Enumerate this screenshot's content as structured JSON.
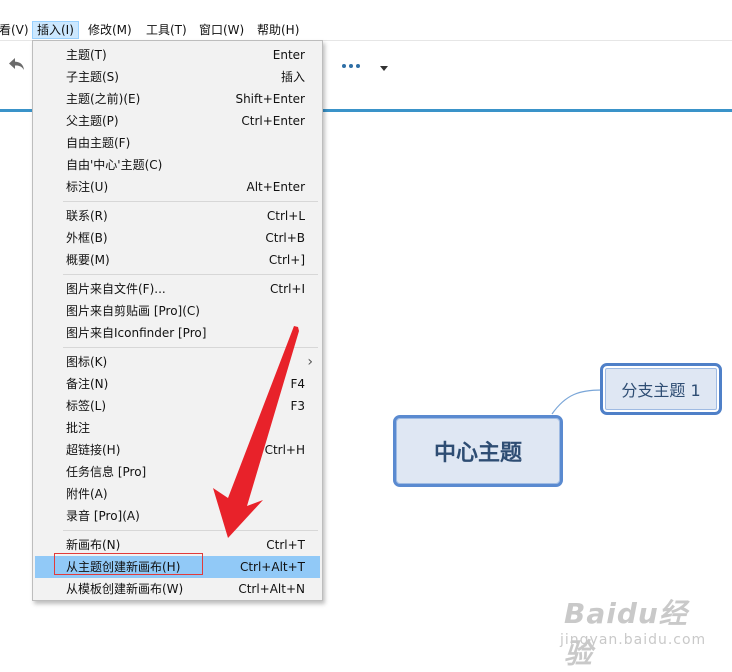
{
  "menubar": [
    {
      "label": "看(V)"
    },
    {
      "label": "插入(I)",
      "active": true
    },
    {
      "label": "修改(M)"
    },
    {
      "label": "工具(T)"
    },
    {
      "label": "窗口(W)"
    },
    {
      "label": "帮助(H)"
    }
  ],
  "toolbar": {
    "undo_icon": "undo-icon",
    "more_icon": "more-horizontal-icon",
    "dropdown_icon": "caret-down-icon"
  },
  "insert_menu": {
    "groups": [
      [
        {
          "label": "主题(T)",
          "shortcut": "Enter"
        },
        {
          "label": "子主题(S)",
          "shortcut": "插入"
        },
        {
          "label": "主题(之前)(E)",
          "shortcut": "Shift+Enter"
        },
        {
          "label": "父主题(P)",
          "shortcut": "Ctrl+Enter"
        },
        {
          "label": "自由主题(F)",
          "shortcut": ""
        },
        {
          "label": "自由'中心'主题(C)",
          "shortcut": ""
        },
        {
          "label": "标注(U)",
          "shortcut": "Alt+Enter"
        }
      ],
      [
        {
          "label": "联系(R)",
          "shortcut": "Ctrl+L"
        },
        {
          "label": "外框(B)",
          "shortcut": "Ctrl+B"
        },
        {
          "label": "概要(M)",
          "shortcut": "Ctrl+]"
        }
      ],
      [
        {
          "label": "图片来自文件(F)...",
          "shortcut": "Ctrl+I"
        },
        {
          "label": "图片来自剪贴画 [Pro](C)",
          "shortcut": ""
        },
        {
          "label": "图片来自Iconfinder [Pro]",
          "shortcut": ""
        }
      ],
      [
        {
          "label": "图标(K)",
          "shortcut": "",
          "submenu": true
        },
        {
          "label": "备注(N)",
          "shortcut": "F4"
        },
        {
          "label": "标签(L)",
          "shortcut": "F3"
        },
        {
          "label": "批注",
          "shortcut": ""
        },
        {
          "label": "超链接(H)",
          "shortcut": "Ctrl+H"
        },
        {
          "label": "任务信息 [Pro]",
          "shortcut": ""
        },
        {
          "label": "附件(A)",
          "shortcut": ""
        },
        {
          "label": "录音 [Pro](A)",
          "shortcut": ""
        }
      ],
      [
        {
          "label": "新画布(N)",
          "shortcut": "Ctrl+T"
        },
        {
          "label": "从主题创建新画布(H)",
          "shortcut": "Ctrl+Alt+T",
          "highlighted": true
        },
        {
          "label": "从模板创建新画布(W)",
          "shortcut": "Ctrl+Alt+N"
        }
      ]
    ]
  },
  "submenu_arrow": "›",
  "mindmap": {
    "central_topic": "中心主题",
    "branch_topic": "分支主题 1"
  },
  "annotation": {
    "arrow_color": "#e8222a",
    "box_color": "#e23b3b"
  },
  "watermark": {
    "brand": "Baidu经验",
    "site": "jingyan.baidu.com"
  },
  "colors": {
    "accent_line": "#3a93c9",
    "menu_highlight": "#91c9f7",
    "topic_border": "#5a8ad0",
    "topic_fill": "#dfe7f3"
  }
}
